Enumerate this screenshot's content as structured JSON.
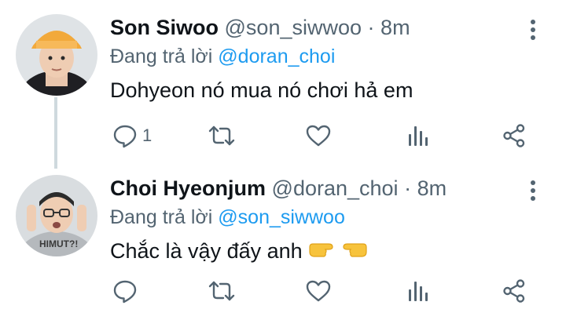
{
  "tweets": [
    {
      "name": "Son Siwoo",
      "handle": "@son_siwwoo",
      "separator": "·",
      "time": "8m",
      "reply_prefix": "Đang trả lời",
      "reply_to": "@doran_choi",
      "text": "Dohyeon nó mua nó chơi hả em",
      "reply_count": "1",
      "avatar_color": "#f5a623"
    },
    {
      "name": "Choi Hyeonjum",
      "handle": "@doran_choi",
      "separator": "·",
      "time": "8m",
      "reply_prefix": "Đang trả lời",
      "reply_to": "@son_siwwoo",
      "text": "Chắc là vậy đấy anh",
      "emojis": [
        "pointing-right-emoji",
        "pointing-left-emoji"
      ],
      "reply_count": "",
      "avatar_color": "#9aa0a6"
    }
  ],
  "colors": {
    "icon": "#536471",
    "link": "#1d9bf0",
    "text": "#0f1419",
    "thread_line": "#cfd9de"
  },
  "icons": [
    "reply-icon",
    "retweet-icon",
    "like-icon",
    "analytics-icon",
    "share-icon",
    "more-options-icon"
  ]
}
